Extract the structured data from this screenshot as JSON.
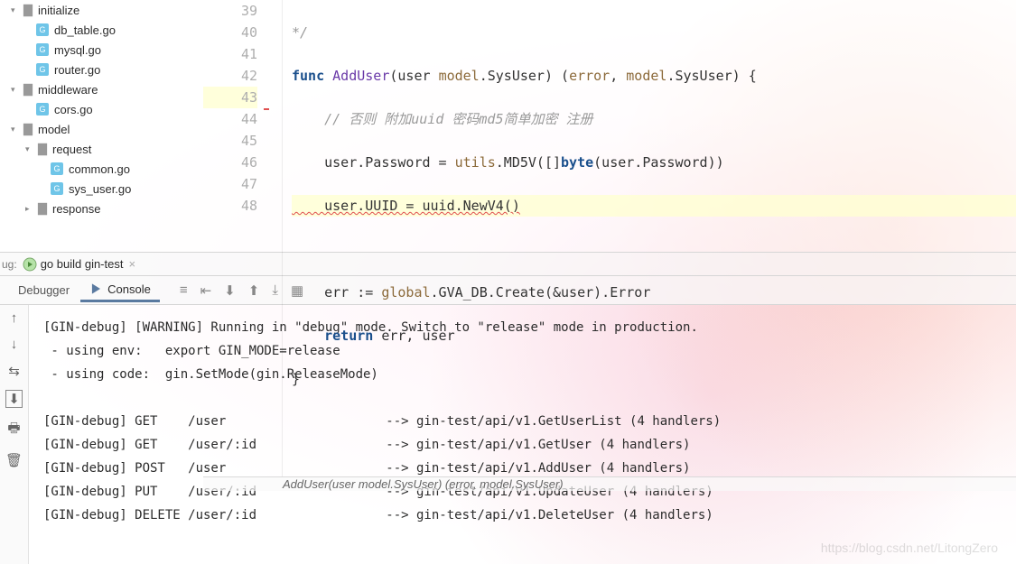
{
  "sidebar": {
    "items": [
      {
        "type": "folder",
        "arrow": "▾",
        "indent": 12,
        "label": "initialize"
      },
      {
        "type": "go",
        "indent": 40,
        "label": "db_table.go"
      },
      {
        "type": "go",
        "indent": 40,
        "label": "mysql.go"
      },
      {
        "type": "go",
        "indent": 40,
        "label": "router.go"
      },
      {
        "type": "folder",
        "arrow": "▾",
        "indent": 12,
        "label": "middleware"
      },
      {
        "type": "go",
        "indent": 40,
        "label": "cors.go"
      },
      {
        "type": "folder",
        "arrow": "▾",
        "indent": 12,
        "label": "model"
      },
      {
        "type": "folder",
        "arrow": "▾",
        "indent": 28,
        "label": "request"
      },
      {
        "type": "go",
        "indent": 56,
        "label": "common.go"
      },
      {
        "type": "go",
        "indent": 56,
        "label": "sys_user.go"
      },
      {
        "type": "folder",
        "arrow": "▸",
        "indent": 28,
        "label": "response",
        "partial": true
      }
    ]
  },
  "editor": {
    "lines": [
      {
        "num": "39",
        "gutter": "*/"
      },
      {
        "num": "40"
      },
      {
        "num": "41"
      },
      {
        "num": "42"
      },
      {
        "num": "43",
        "current": true
      },
      {
        "num": "44"
      },
      {
        "num": "45"
      },
      {
        "num": "46"
      },
      {
        "num": "47"
      },
      {
        "num": "48"
      }
    ],
    "code": {
      "l40": {
        "kw_func": "func",
        "fn": "AddUser",
        "arg": "(user ",
        "pkg1": "model",
        "typ1": ".SysUser) (",
        "pkg2": "error",
        "typ2": ", ",
        "pkg3": "model",
        "typ3": ".SysUser) {"
      },
      "l41_comment": "// 否则 附加uuid 密码md5简单加密 注册",
      "l42_prefix": "    user.Password = ",
      "l42_pkg": "utils",
      "l42_fn": ".MD5V([]",
      "l42_kw": "byte",
      "l42_paren": "(user.Password))",
      "l43_text": "    user.UUID = uuid.NewV4()",
      "l45_prefix": "    err := ",
      "l45_pkg": "global",
      "l45_call": ".GVA_DB.Create(&user).Error",
      "l46_kw": "return",
      "l46_rest": " err, user",
      "l47": "}"
    },
    "breadcrumb": "AddUser(user model.SysUser) (error, model.SysUser)"
  },
  "run": {
    "label": "ug:",
    "config": "go build gin-test"
  },
  "tabs": {
    "debugger": "Debugger",
    "console": "Console"
  },
  "toolicons": [
    "≡",
    "⇤",
    "⬇",
    "⬆",
    "⤓",
    "▦"
  ],
  "rail": [
    "↑",
    "↓",
    "⇆",
    "⬇",
    "🖶",
    "🗑"
  ],
  "console_lines": [
    "[GIN-debug] [WARNING] Running in \"debug\" mode. Switch to \"release\" mode in production.",
    " - using env:   export GIN_MODE=release",
    " - using code:  gin.SetMode(gin.ReleaseMode)",
    "",
    "[GIN-debug] GET    /user                     --> gin-test/api/v1.GetUserList (4 handlers)",
    "[GIN-debug] GET    /user/:id                 --> gin-test/api/v1.GetUser (4 handlers)",
    "[GIN-debug] POST   /user                     --> gin-test/api/v1.AddUser (4 handlers)",
    "[GIN-debug] PUT    /user/:id                 --> gin-test/api/v1.UpdateUser (4 handlers)",
    "[GIN-debug] DELETE /user/:id                 --> gin-test/api/v1.DeleteUser (4 handlers)"
  ],
  "watermark": "https://blog.csdn.net/LitongZero"
}
